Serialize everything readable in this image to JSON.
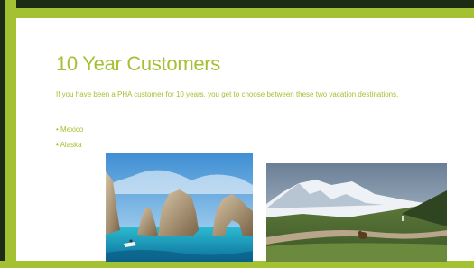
{
  "slide": {
    "title": "10 Year Customers",
    "body": "If you have been a PHA customer for 10 years, you get to choose between these two vacation destinations.",
    "bullets": [
      "• Mexico",
      "• Alaska"
    ]
  },
  "images": {
    "mexico_alt": "Mexico coastal rock arch photo",
    "alaska_alt": "Alaska mountain road photo"
  },
  "colors": {
    "accent": "#a3c132",
    "dark_border": "#1d2a14"
  }
}
